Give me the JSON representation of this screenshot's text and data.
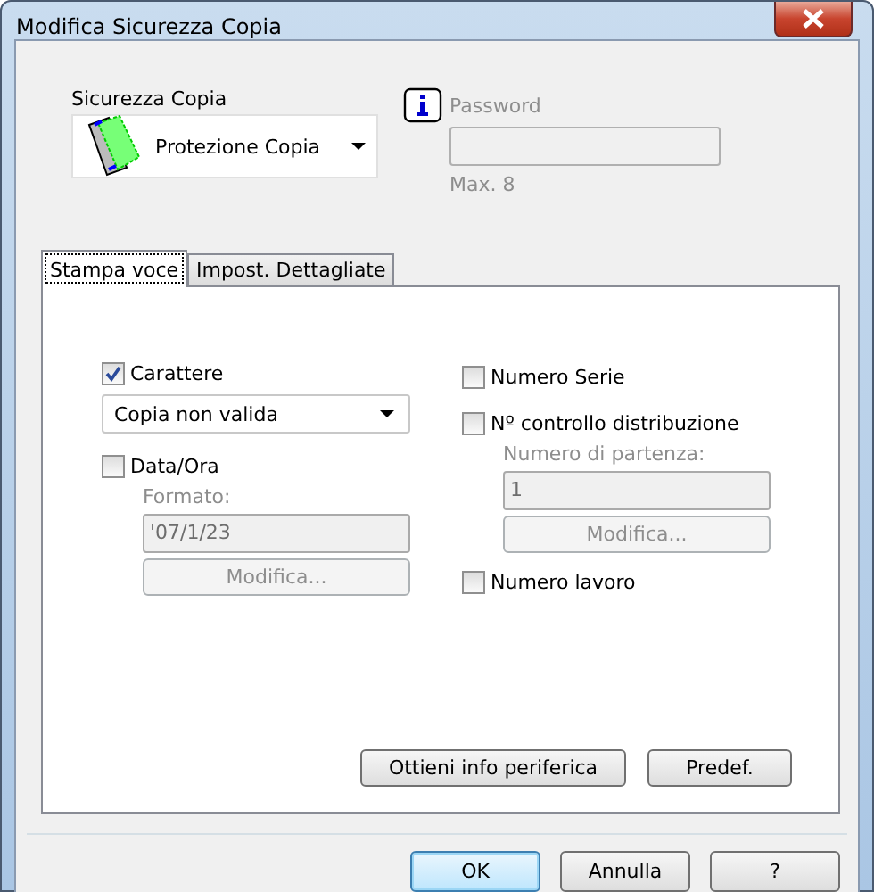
{
  "window": {
    "title": "Modifica Sicurezza Copia"
  },
  "security": {
    "label": "Sicurezza Copia",
    "value": "Protezione Copia"
  },
  "password": {
    "label": "Password",
    "disabled": true,
    "hint": "Max. 8"
  },
  "tabs": [
    {
      "label": "Stampa voce",
      "selected": true
    },
    {
      "label": "Impost. Dettagliate",
      "selected": false
    }
  ],
  "character": {
    "label": "Carattere",
    "checked": true,
    "value": "Copia non valida"
  },
  "date": {
    "label": "Data/Ora",
    "checked": false,
    "format_label": "Formato:",
    "format_value": "'07/1/23",
    "button": "Modifica...",
    "disabled": true
  },
  "serial": {
    "label": "Numero Serie",
    "checked": false
  },
  "distribution": {
    "label": "Nº controllo distribuzione",
    "checked": false,
    "start_label": "Numero di partenza:",
    "start_value": "1",
    "button": "Modifica...",
    "disabled": true
  },
  "job": {
    "label": "Numero lavoro",
    "checked": false
  },
  "panel_buttons": [
    "Ottieni info periferica",
    "Predef."
  ],
  "dialog_buttons": [
    {
      "label": "OK",
      "default": true
    },
    {
      "label": "Annulla",
      "default": false
    },
    {
      "label": "?",
      "default": false
    }
  ]
}
